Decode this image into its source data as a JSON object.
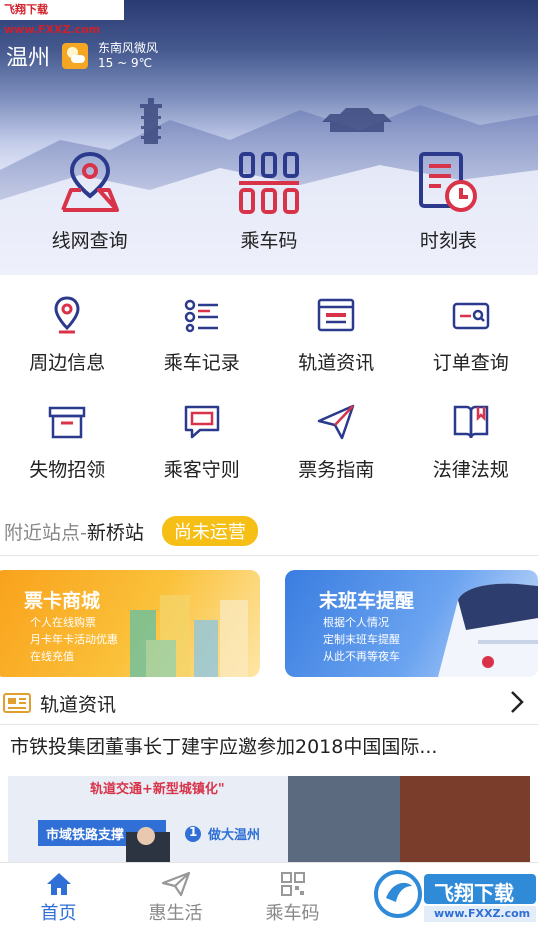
{
  "watermark_top": "飞翔下载 www.FXXZ.com",
  "weather": {
    "city": "温州",
    "wind": "东南风微风",
    "temp": "15 ~ 9℃"
  },
  "main_actions": [
    {
      "label": "线网查询",
      "icon": "map-icon"
    },
    {
      "label": "乘车码",
      "icon": "qr-code-icon"
    },
    {
      "label": "时刻表",
      "icon": "timetable-icon"
    }
  ],
  "grid": [
    {
      "label": "周边信息",
      "icon": "location-icon"
    },
    {
      "label": "乘车记录",
      "icon": "list-icon"
    },
    {
      "label": "轨道资讯",
      "icon": "news-icon"
    },
    {
      "label": "订单查询",
      "icon": "order-search-icon"
    },
    {
      "label": "失物招领",
      "icon": "box-icon"
    },
    {
      "label": "乘客守则",
      "icon": "chat-icon"
    },
    {
      "label": "票务指南",
      "icon": "send-icon"
    },
    {
      "label": "法律法规",
      "icon": "book-icon"
    }
  ],
  "nearby": {
    "label": "附近站点-",
    "station": "新桥站",
    "status": "尚未运营"
  },
  "banners": [
    {
      "title": "票卡商城",
      "lines": [
        "个人在线购票",
        "月卡年卡活动优惠",
        "在线充值"
      ]
    },
    {
      "title": "末班车提醒",
      "lines": [
        "根据个人情况",
        "定制末班车提醒",
        "从此不再等夜车"
      ]
    }
  ],
  "news": {
    "section_title": "轨道资讯",
    "headline": "市铁投集团董事长丁建宇应邀参加2018中国国际...",
    "image_text_top": "轨道交通+新型城镇化\"",
    "image_text_left": "市域铁路支撑",
    "image_text_num": "1",
    "image_text_right": "做大温州"
  },
  "tabs": [
    {
      "label": "首页",
      "icon": "home-icon",
      "active": true
    },
    {
      "label": "惠生活",
      "icon": "paper-plane-icon",
      "active": false
    },
    {
      "label": "乘车码",
      "icon": "qr-tab-icon",
      "active": false
    }
  ],
  "watermark_bottom": {
    "brand": "飞翔下载",
    "url": "www.FXXZ.com"
  },
  "colors": {
    "accent": "#2f6fd6",
    "icon_red": "#d9334a",
    "icon_navy": "#2b3a8c",
    "badge": "#f6bf15"
  }
}
